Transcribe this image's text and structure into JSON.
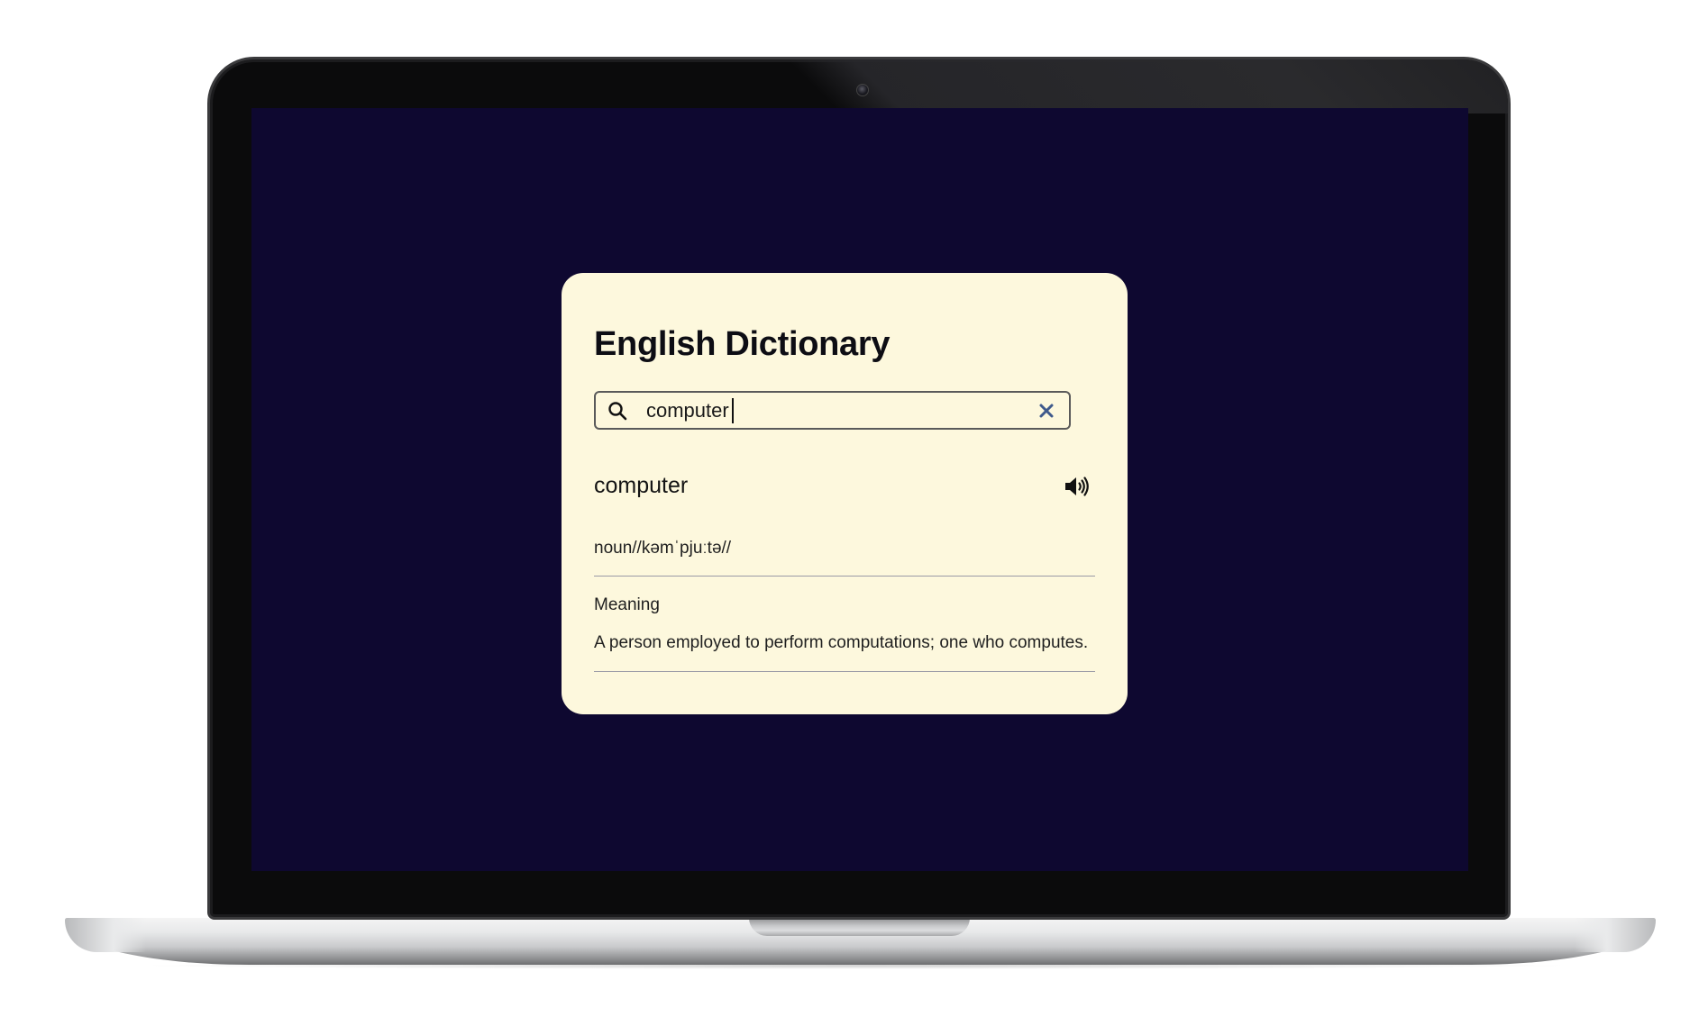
{
  "app": {
    "title": "English Dictionary"
  },
  "search": {
    "value": "computer",
    "icon": "search-icon",
    "clear_icon": "close-icon"
  },
  "result": {
    "word": "computer",
    "audio_icon": "speaker-icon",
    "phonetic": "noun//kəmˈpjuːtə//",
    "meaning_label": "Meaning",
    "meaning": "A person employed to perform computations; one who computes."
  },
  "colors": {
    "screen_background": "#0e0830",
    "card_background": "#fdf8dd",
    "clear_icon": "#3f5a8c"
  }
}
